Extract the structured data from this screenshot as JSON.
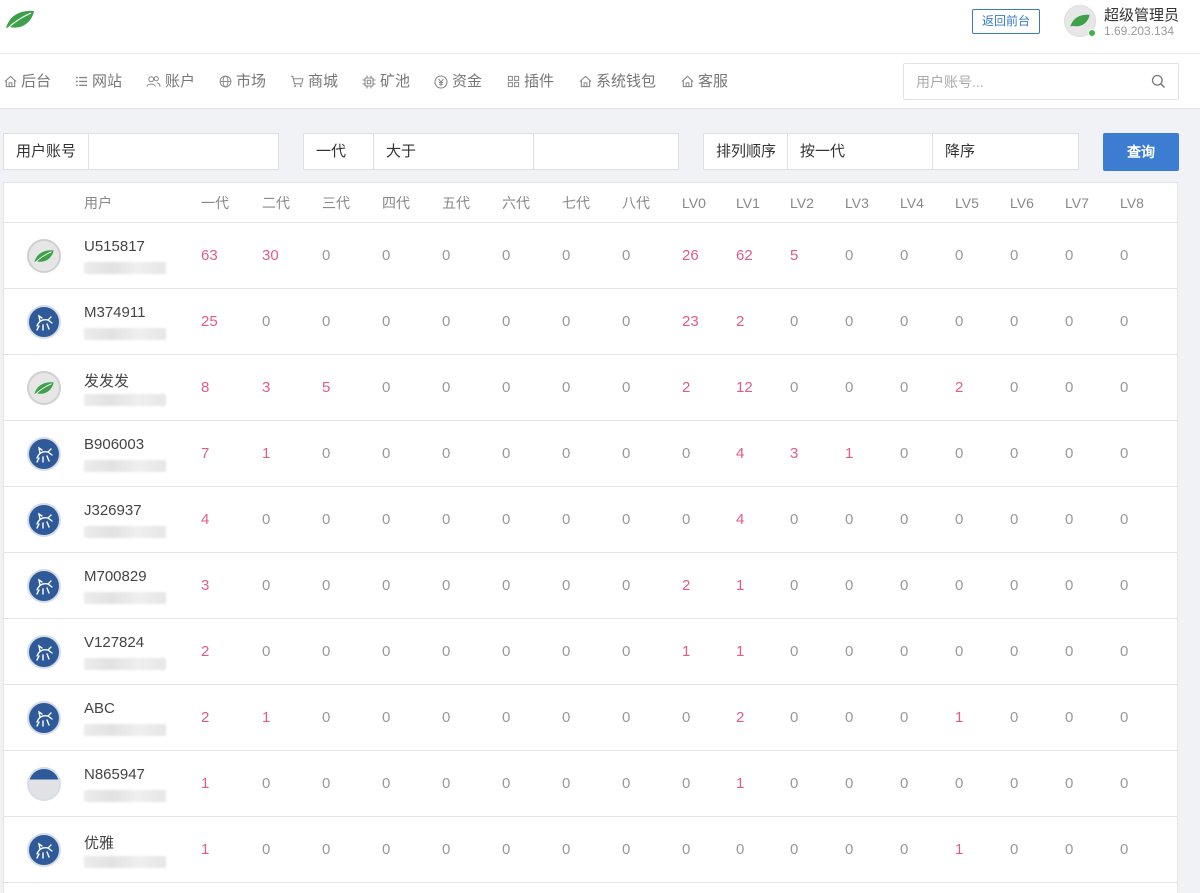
{
  "header": {
    "back_button": "返回前台",
    "admin_name": "超级管理员",
    "admin_ip": "1.69.203.134"
  },
  "nav": {
    "items": [
      {
        "label": "后台",
        "icon": "home-icon"
      },
      {
        "label": "网站",
        "icon": "list-icon"
      },
      {
        "label": "账户",
        "icon": "users-icon"
      },
      {
        "label": "市场",
        "icon": "globe-icon"
      },
      {
        "label": "商城",
        "icon": "cart-icon"
      },
      {
        "label": "矿池",
        "icon": "chip-icon"
      },
      {
        "label": "资金",
        "icon": "coin-icon"
      },
      {
        "label": "插件",
        "icon": "grid-icon"
      },
      {
        "label": "系统钱包",
        "icon": "home-icon"
      },
      {
        "label": "客服",
        "icon": "home-icon"
      }
    ],
    "search_placeholder": "用户账号..."
  },
  "filters": {
    "account_label": "用户账号",
    "account_value": "",
    "generation_label": "一代",
    "compare_label": "大于",
    "compare_value": "",
    "sort_label": "排列顺序",
    "sort_by": "按一代",
    "sort_order": "降序",
    "query_button": "查询"
  },
  "table": {
    "columns": [
      "用户",
      "一代",
      "二代",
      "三代",
      "四代",
      "五代",
      "六代",
      "七代",
      "八代",
      "LV0",
      "LV1",
      "LV2",
      "LV3",
      "LV4",
      "LV5",
      "LV6",
      "LV7",
      "LV8"
    ],
    "rows": [
      {
        "name": "U515817",
        "avatar": "leaf",
        "values": [
          63,
          30,
          0,
          0,
          0,
          0,
          0,
          0,
          26,
          62,
          5,
          0,
          0,
          0,
          0,
          0,
          0
        ]
      },
      {
        "name": "M374911",
        "avatar": "zodiac",
        "values": [
          25,
          0,
          0,
          0,
          0,
          0,
          0,
          0,
          23,
          2,
          0,
          0,
          0,
          0,
          0,
          0,
          0
        ]
      },
      {
        "name": "发发发",
        "avatar": "leaf",
        "values": [
          8,
          3,
          5,
          0,
          0,
          0,
          0,
          0,
          2,
          12,
          0,
          0,
          0,
          2,
          0,
          0,
          0
        ]
      },
      {
        "name": "B906003",
        "avatar": "zodiac",
        "values": [
          7,
          1,
          0,
          0,
          0,
          0,
          0,
          0,
          0,
          4,
          3,
          1,
          0,
          0,
          0,
          0,
          0
        ]
      },
      {
        "name": "J326937",
        "avatar": "zodiac",
        "values": [
          4,
          0,
          0,
          0,
          0,
          0,
          0,
          0,
          0,
          4,
          0,
          0,
          0,
          0,
          0,
          0,
          0
        ]
      },
      {
        "name": "M700829",
        "avatar": "zodiac",
        "values": [
          3,
          0,
          0,
          0,
          0,
          0,
          0,
          0,
          2,
          1,
          0,
          0,
          0,
          0,
          0,
          0,
          0
        ]
      },
      {
        "name": "V127824",
        "avatar": "zodiac",
        "values": [
          2,
          0,
          0,
          0,
          0,
          0,
          0,
          0,
          1,
          1,
          0,
          0,
          0,
          0,
          0,
          0,
          0
        ]
      },
      {
        "name": "ABC",
        "avatar": "zodiac",
        "values": [
          2,
          1,
          0,
          0,
          0,
          0,
          0,
          0,
          0,
          2,
          0,
          0,
          0,
          1,
          0,
          0,
          0
        ]
      },
      {
        "name": "N865947",
        "avatar": "plain",
        "values": [
          1,
          0,
          0,
          0,
          0,
          0,
          0,
          0,
          0,
          1,
          0,
          0,
          0,
          0,
          0,
          0,
          0
        ]
      },
      {
        "name": "优雅",
        "avatar": "zodiac",
        "values": [
          1,
          0,
          0,
          0,
          0,
          0,
          0,
          0,
          0,
          0,
          0,
          0,
          0,
          1,
          0,
          0,
          0
        ]
      }
    ]
  },
  "colors": {
    "accent": "#3c7dd1",
    "highlight": "#e25a8a",
    "muted": "#999999",
    "leaf": "#3fa04a"
  }
}
